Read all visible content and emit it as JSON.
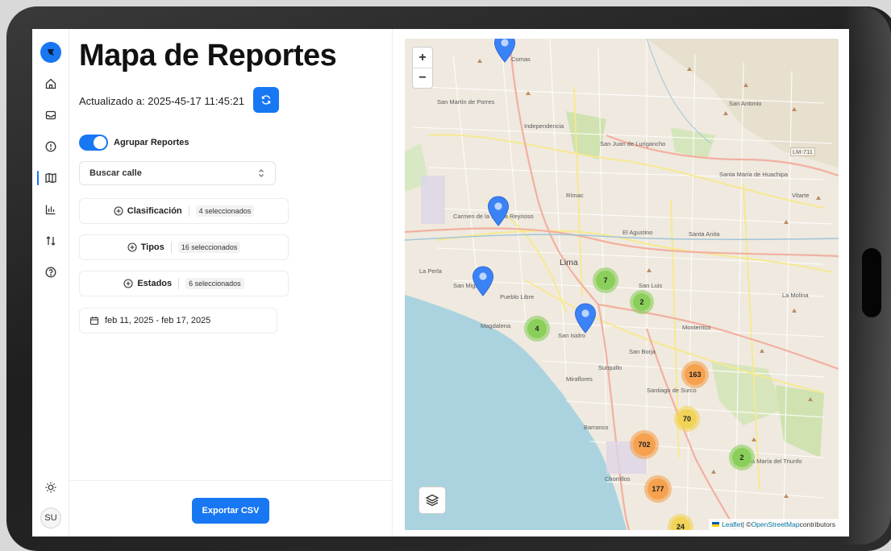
{
  "header": {
    "title": "Mapa de Reportes",
    "updated_text": "Actualizado a: 2025-45-17 11:45:21"
  },
  "controls": {
    "group_toggle_label": "Agrupar Reportes",
    "group_toggle_on": true,
    "street_placeholder": "Buscar calle",
    "filters": [
      {
        "label": "Clasificación",
        "badge": "4 seleccionados"
      },
      {
        "label": "Tipos",
        "badge": "16 seleccionados"
      },
      {
        "label": "Estados",
        "badge": "6 seleccionados"
      }
    ],
    "date_range": "feb 11, 2025 - feb 17, 2025",
    "export_label": "Exportar CSV"
  },
  "sidebar": {
    "avatar_initials": "SU",
    "items": [
      "home-icon",
      "inbox-icon",
      "alert-icon",
      "map-icon",
      "chart-icon",
      "sort-icon",
      "help-icon"
    ],
    "active_item": "map-icon",
    "theme_icon": "sun-icon"
  },
  "map": {
    "zoom_in": "+",
    "zoom_out": "−",
    "attribution_leaflet": "Leaflet",
    "attribution_sep": " | © ",
    "attribution_osm": "OpenStreetMap",
    "attribution_tail": " contributors",
    "places": [
      "Comas",
      "San Martín de Porres",
      "Independencia",
      "San Juan de Lurigancho",
      "San Antonio",
      "Santa María de Huachipa",
      "Vitarte",
      "Rímac",
      "Carmen de la Legua Reynoso",
      "El Agustino",
      "Santa Anita",
      "La Perla",
      "San Miguel",
      "Pueblo Libre",
      "Lima",
      "San Luis",
      "La Molina",
      "Magdalena",
      "San Isidro",
      "San Borja",
      "Monterrico",
      "Surquillo",
      "Miraflores",
      "Santiago de Surco",
      "Barranco",
      "Villa María del Triunfo",
      "Chorrillos",
      "LM-711"
    ],
    "clusters": [
      {
        "count": "7",
        "level": "green"
      },
      {
        "count": "2",
        "level": "green"
      },
      {
        "count": "4",
        "level": "green"
      },
      {
        "count": "163",
        "level": "orange"
      },
      {
        "count": "70",
        "level": "yellow"
      },
      {
        "count": "702",
        "level": "orange"
      },
      {
        "count": "2",
        "level": "green"
      },
      {
        "count": "177",
        "level": "orange"
      },
      {
        "count": "24",
        "level": "yellow"
      }
    ],
    "colors": {
      "green": "#8bcf5b",
      "yellow": "#f1d357",
      "orange": "#f5a14e",
      "pin": "#3b82f6",
      "sea": "#aad3df",
      "accent": "#1877f2"
    }
  }
}
